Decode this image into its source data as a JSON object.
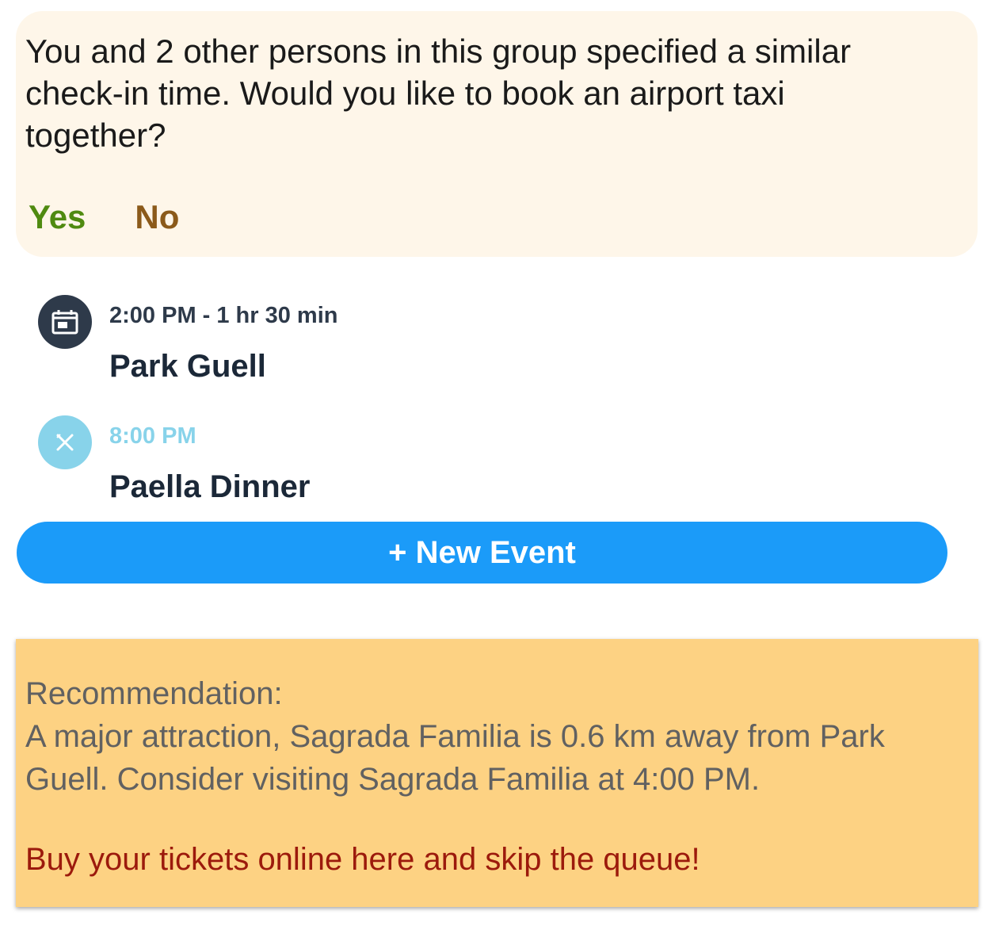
{
  "taxi_suggestion": {
    "message": "You and 2 other persons in this group specified a similar\ncheck-in time. Would you like to book an airport taxi\ntogether?",
    "yes_label": "Yes",
    "no_label": "No"
  },
  "events": [
    {
      "time": "2:00 PM - 1 hr 30 min",
      "title": "Park Guell",
      "icon": "calendar-icon",
      "color": "#2e3a4a"
    },
    {
      "time": "8:00 PM",
      "title": "Paella Dinner",
      "icon": "utensils-icon",
      "color": "#88d3ea"
    }
  ],
  "new_event_label": "+ New Event",
  "recommendation": {
    "heading": "Recommendation:",
    "body": "A major attraction, Sagrada Familia is 0.6 km away from Park Guell. Consider visiting Sagrada Familia at 4:00 PM.",
    "link_text": "Buy your tickets online here and skip the queue!"
  },
  "colors": {
    "accent_blue": "#1b9bf9",
    "yes_green": "#4f8a10",
    "no_brown": "#8b5a1a",
    "taxi_card_bg": "#fef6e9",
    "recommendation_bg": "#fdd283",
    "link_red": "#9c1a0c"
  }
}
